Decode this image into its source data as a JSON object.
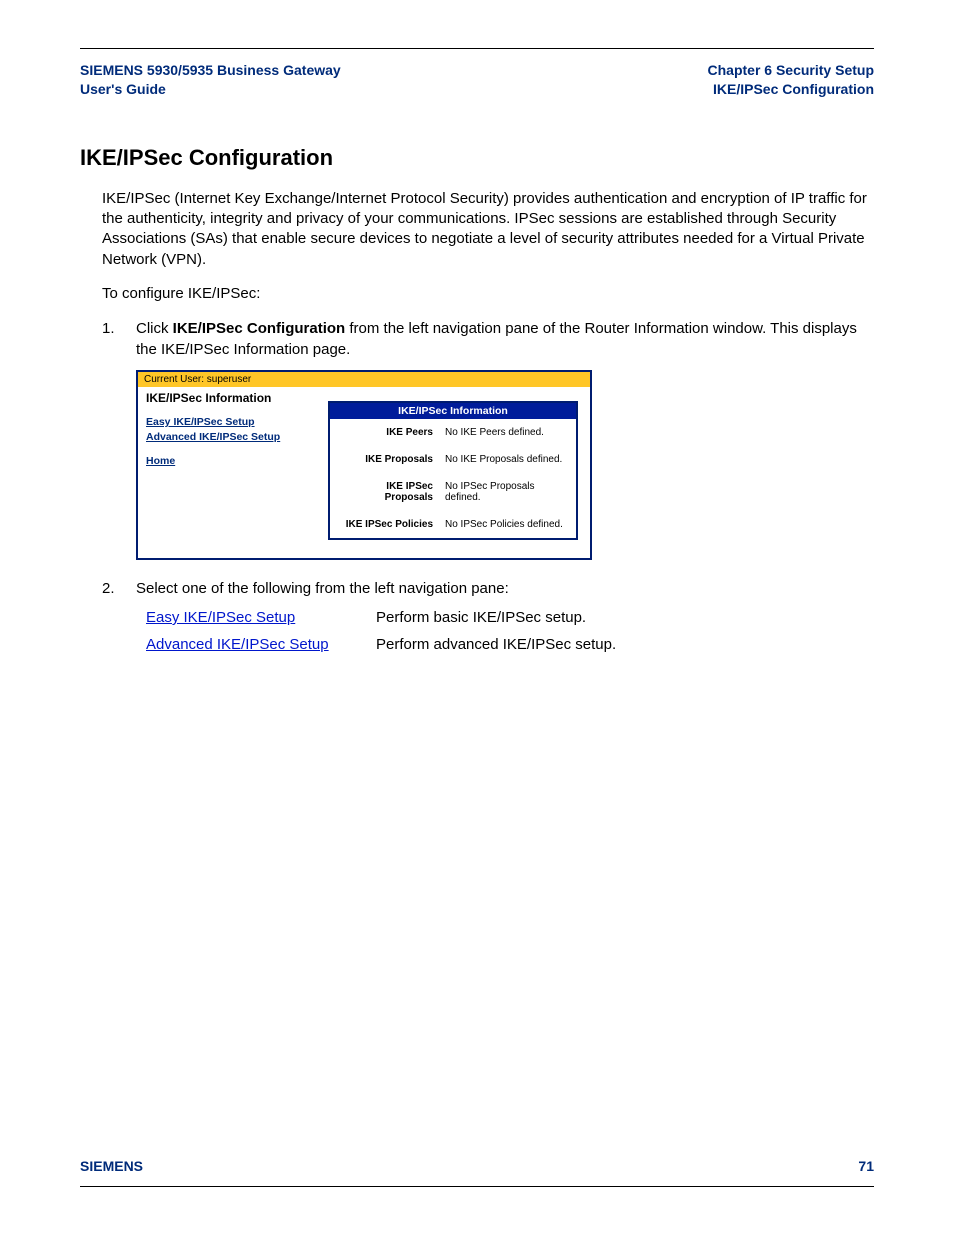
{
  "header": {
    "left_line1": "SIEMENS 5930/5935 Business Gateway",
    "left_line2": "User's Guide",
    "right_line1": "Chapter 6  Security Setup",
    "right_line2": "IKE/IPSec Configuration"
  },
  "title": "IKE/IPSec Configuration",
  "intro": "IKE/IPSec (Internet Key Exchange/Internet Protocol Security) provides authentication and encryption of IP traffic for the authenticity, integrity and privacy of your communications. IPSec sessions are established through Security Associations (SAs) that enable secure devices to negotiate a level of security attributes needed for a Virtual Private Network (VPN).",
  "lead": "To configure IKE/IPSec:",
  "step1_num": "1.",
  "step1_pre": "Click ",
  "step1_bold": "IKE/IPSec Configuration",
  "step1_post": " from the left navigation pane of the Router Information window. This displays the IKE/IPSec Information page.",
  "screenshot": {
    "current_user": "Current User: superuser",
    "panel_title": "IKE/IPSec Information",
    "nav": {
      "easy": "Easy IKE/IPSec Setup",
      "advanced": "Advanced IKE/IPSec Setup",
      "home": "Home"
    },
    "table_header": "IKE/IPSec Information",
    "rows": [
      {
        "label": "IKE Peers",
        "value": "No IKE Peers defined."
      },
      {
        "label": "IKE Proposals",
        "value": "No IKE Proposals defined."
      },
      {
        "label": "IKE IPSec Proposals",
        "value": "No IPSec Proposals defined."
      },
      {
        "label": "IKE IPSec Policies",
        "value": "No IPSec Policies defined."
      }
    ]
  },
  "step2_num": "2.",
  "step2_text": "Select one of the following from the left navigation pane:",
  "options": [
    {
      "link": "Easy IKE/IPSec Setup",
      "desc": "Perform basic IKE/IPSec setup."
    },
    {
      "link": "Advanced IKE/IPSec Setup",
      "desc": "Perform advanced IKE/IPSec setup."
    }
  ],
  "footer": {
    "brand": "SIEMENS",
    "page": "71"
  }
}
